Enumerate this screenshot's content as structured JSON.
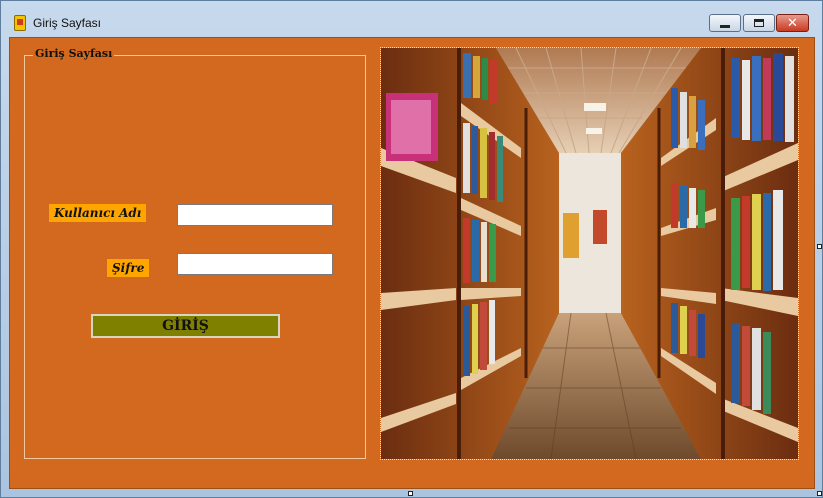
{
  "window": {
    "title": "Giriş Sayfası",
    "controls": {
      "minimize": "minimize",
      "maximize": "maximize",
      "close": "✕"
    }
  },
  "form": {
    "group_title": "Giriş Sayfası",
    "username_label": "Kullanıcı Adı",
    "username_value": "",
    "password_label": "Şifre",
    "password_value": "",
    "login_button": "GİRİŞ"
  },
  "colors": {
    "form_background": "#d2691e",
    "label_background": "#ffa500",
    "button_background": "#808000"
  },
  "image": {
    "subject": "library-bookshelves-corridor"
  }
}
